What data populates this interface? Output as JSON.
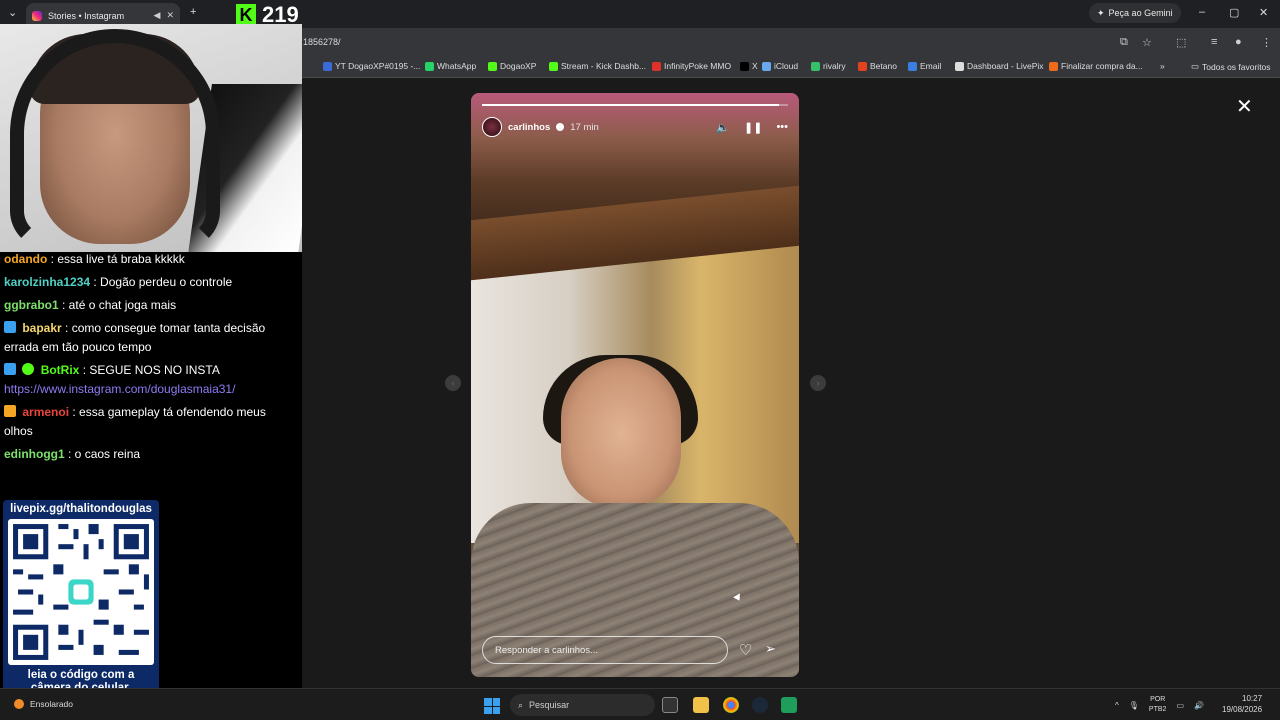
{
  "browser": {
    "tab_title": "Stories • Instagram",
    "url_fragment": "1856278/",
    "gemini_label": "Peça ao Gemini",
    "kick_count": "219",
    "bookmarks": [
      {
        "label": "YT DogaoXP#0195 -...",
        "color": "#3a6bd6"
      },
      {
        "label": "WhatsApp",
        "color": "#25d366"
      },
      {
        "label": "DogaoXP",
        "color": "#53fc18"
      },
      {
        "label": "Stream - Kick Dashb...",
        "color": "#53fc18"
      },
      {
        "label": "InfinityPoke MMO",
        "color": "#e0302a"
      },
      {
        "label": "X",
        "color": "#000000"
      },
      {
        "label": "iCloud",
        "color": "#6aa9f0"
      },
      {
        "label": "rivalry",
        "color": "#36c06a"
      },
      {
        "label": "Betano",
        "color": "#e4421d"
      },
      {
        "label": "Email",
        "color": "#3a7ee0"
      },
      {
        "label": "Dashboard - LivePix",
        "color": "#dddddd"
      },
      {
        "label": "Finalizar compra da...",
        "color": "#ee6b1c"
      }
    ],
    "all_bookmarks_label": "Todos os favoritos"
  },
  "chat": {
    "messages": [
      {
        "user": "odando",
        "user_color": "#f5a623",
        "text": ": essa live tá braba kkkkk",
        "badge": null
      },
      {
        "user": "karolzinha1234",
        "user_color": "#4fd1c5",
        "text": ": Dogão perdeu o controle",
        "badge": null
      },
      {
        "user": "ggbrabo1",
        "user_color": "#7ee06a",
        "text": ": até o chat joga mais",
        "badge": null
      },
      {
        "user": "bapakr",
        "user_color": "#f5d76e",
        "text": ": como consegue tomar tanta decisão errada em tão pouco tempo",
        "badge": "#3aa0f0"
      },
      {
        "user": "BotRix",
        "user_color": "#53fc18",
        "text": ": SEGUE NOS NO INSTA",
        "badge": "#3aa0f0"
      },
      {
        "user": "armenoi",
        "user_color": "#e8453c",
        "text": ": essa gameplay tá ofendendo meus olhos",
        "badge": "#f5a623"
      },
      {
        "user": "edinhogg1",
        "user_color": "#7ee06a",
        "text": ": o caos reina",
        "badge": null
      }
    ],
    "botrix_link": "https://www.instagram.com/douglasmaia31/"
  },
  "qr": {
    "url": "livepix.gg/thalitondouglas",
    "caption": "leia o código com a câmera do celular."
  },
  "story": {
    "username": "carlinhos",
    "time": "17 min",
    "reply_placeholder": "Responder a carlinhos...",
    "progress": 0.97
  },
  "taskbar": {
    "weather": "Ensolarado",
    "search_placeholder": "Pesquisar",
    "lang_line1": "POR",
    "lang_line2": "PTB2",
    "time": "10:27",
    "date": "19/08/2026"
  }
}
